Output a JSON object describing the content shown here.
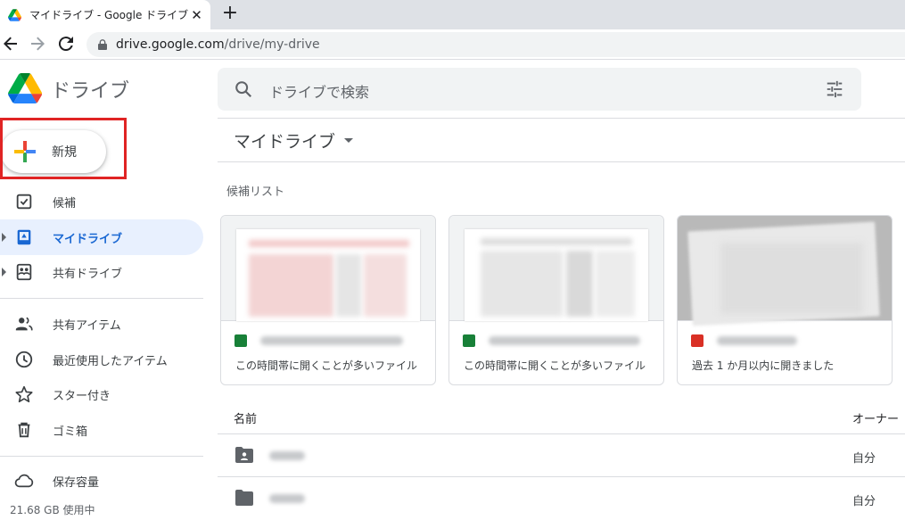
{
  "browser": {
    "tab_title": "マイドライブ - Google ドライブ",
    "tab_close": "✕",
    "new_tab": "+",
    "url_host": "drive.google.com",
    "url_path": "/drive/my-drive"
  },
  "header": {
    "app_name": "ドライブ",
    "search_placeholder": "ドライブで検索"
  },
  "sidebar": {
    "new_label": "新規",
    "items": [
      {
        "label": "候補",
        "icon": "suggested-icon"
      },
      {
        "label": "マイドライブ",
        "icon": "my-drive-icon",
        "active": true
      },
      {
        "label": "共有ドライブ",
        "icon": "shared-drives-icon"
      },
      {
        "label": "共有アイテム",
        "icon": "shared-with-me-icon"
      },
      {
        "label": "最近使用したアイテム",
        "icon": "recent-icon"
      },
      {
        "label": "スター付き",
        "icon": "star-icon"
      },
      {
        "label": "ゴミ箱",
        "icon": "trash-icon"
      },
      {
        "label": "保存容量",
        "icon": "cloud-icon"
      }
    ],
    "storage_used": "21.68 GB 使用中"
  },
  "main": {
    "breadcrumb": "マイドライブ",
    "suggested_title": "候補リスト",
    "cards": [
      {
        "type": "sheets",
        "reason": "この時間帯に開くことが多いファイル"
      },
      {
        "type": "sheets",
        "reason": "この時間帯に開くことが多いファイル"
      },
      {
        "type": "image",
        "reason": "過去 1 か月以内に開きました"
      }
    ],
    "columns": {
      "name": "名前",
      "owner": "オーナー"
    },
    "rows": [
      {
        "icon": "shared-folder-icon",
        "owner": "自分"
      },
      {
        "icon": "folder-icon",
        "owner": "自分"
      }
    ]
  },
  "colors": {
    "accent": "#1967d2",
    "active_bg": "#e8f0fe",
    "highlight_box": "#e02424",
    "sheets_green": "#188038",
    "image_red": "#d93025"
  }
}
